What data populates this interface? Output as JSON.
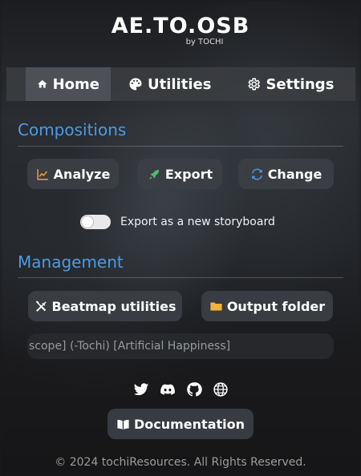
{
  "app": {
    "logo_title": "AE.TO.OSB",
    "logo_sub": "by TOCHI"
  },
  "nav": {
    "items": [
      {
        "label": "Home",
        "icon": "home-icon",
        "active": true
      },
      {
        "label": "Utilities",
        "icon": "palette-icon",
        "active": false
      },
      {
        "label": "Settings",
        "icon": "gear-icon",
        "active": false
      }
    ]
  },
  "compositions": {
    "title": "Compositions",
    "buttons": [
      {
        "label": "Analyze",
        "icon": "chart-line-icon"
      },
      {
        "label": "Export",
        "icon": "rocket-icon"
      },
      {
        "label": "Change",
        "icon": "refresh-icon"
      }
    ],
    "toggle_label": "Export as a new storyboard",
    "toggle_on": false
  },
  "management": {
    "title": "Management",
    "buttons": [
      {
        "label": "Beatmap utilities",
        "icon": "tools-icon"
      },
      {
        "label": "Output folder",
        "icon": "folder-icon"
      }
    ],
    "marquee_text": "scope] (-Tochi) [Artificial Happiness]"
  },
  "socials": [
    "twitter-icon",
    "discord-icon",
    "github-icon",
    "globe-icon"
  ],
  "documentation_label": "Documentation",
  "footer": "© 2024 tochiResources. All Rights Reserved.",
  "colors": {
    "accent": "#4a9be8",
    "analyze_icon": "#f0a63a",
    "export_icon": "#4cbf6b",
    "change_icon": "#4a9be8",
    "folder_icon": "#f2b33d"
  }
}
